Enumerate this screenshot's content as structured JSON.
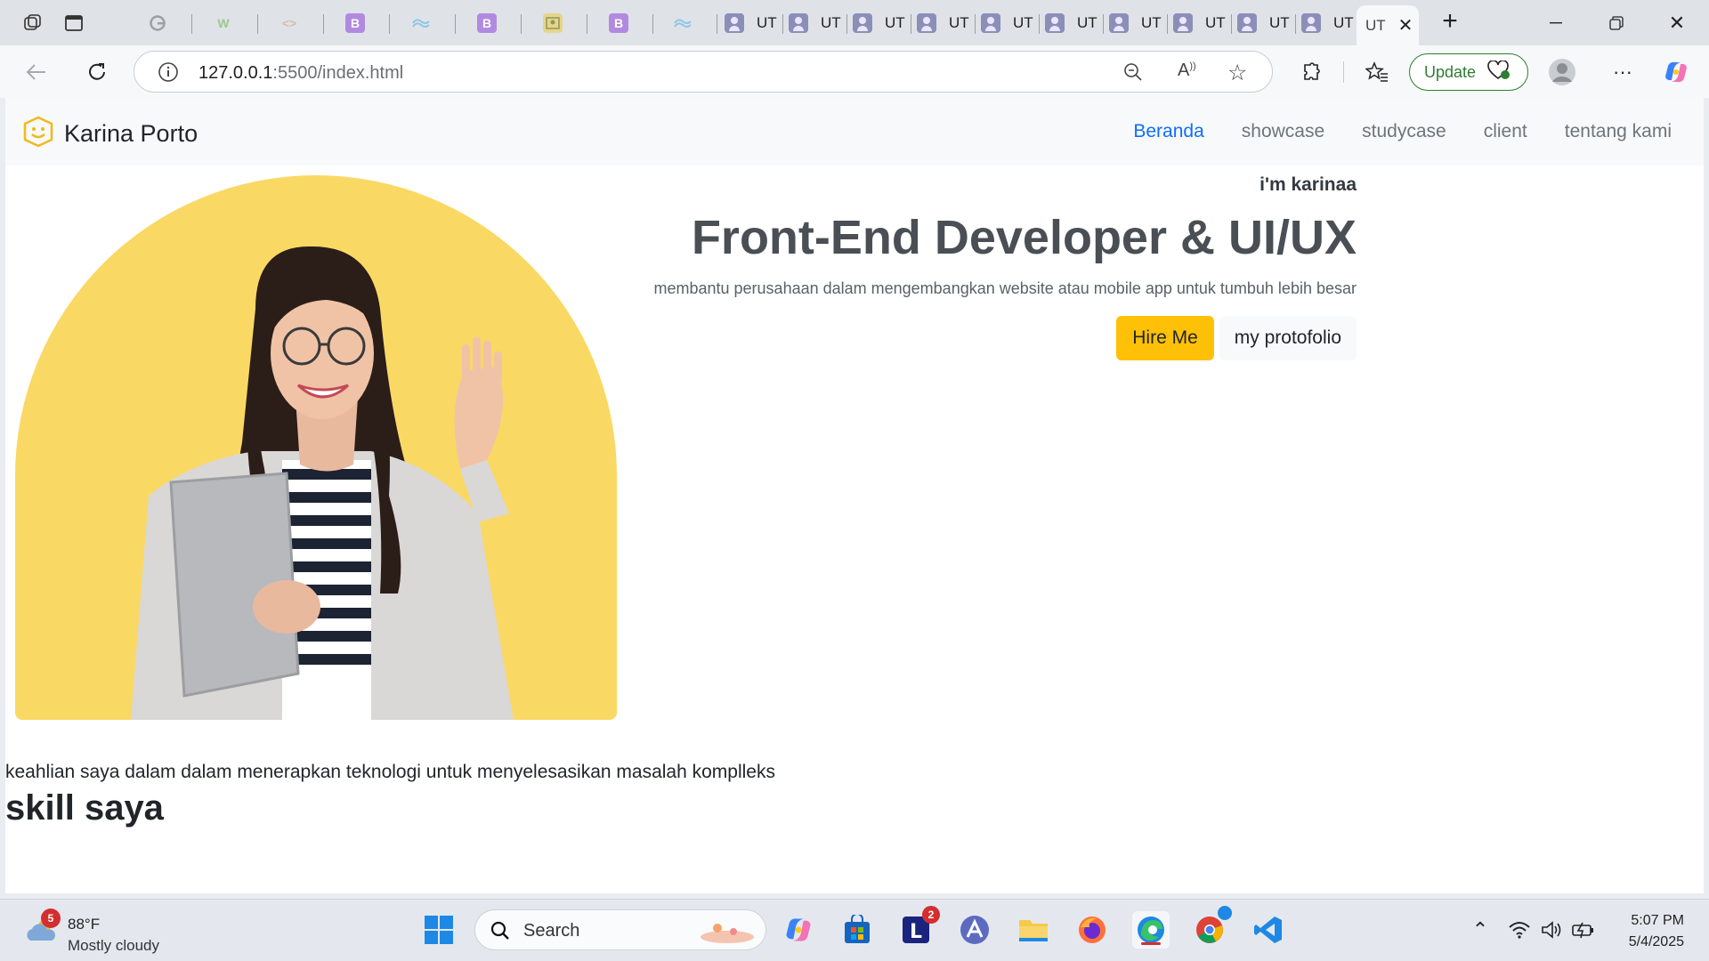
{
  "browser": {
    "tab_title_short": "UT",
    "active_tab_title": "UT",
    "url_host": "127.0.0.1",
    "url_rest": ":5500/index.html",
    "update_label": "Update"
  },
  "site": {
    "brand": "Karina Porto",
    "nav": [
      "Beranda",
      "showcase",
      "studycase",
      "client",
      "tentang kami"
    ],
    "greeting": "i'm karinaa",
    "headline": "Front-End Developer & UI/UX",
    "lead": "membantu perusahaan dalam mengembangkan website atau mobile app untuk tumbuh lebih besar",
    "hire_label": "Hire Me",
    "portfolio_label": "my protofolio",
    "skill_subtitle": "keahlian saya dalam dalam menerapkan teknologi untuk menyelesasikan masalah komplleks",
    "skill_title": "skill saya",
    "hero_bg_color": "#fad864"
  },
  "taskbar": {
    "weather_temp": "88°F",
    "weather_cond": "Mostly cloudy",
    "weather_badge": "5",
    "search_placeholder": "Search",
    "lens_badge": "2",
    "time": "5:07 PM",
    "date": "5/4/2025"
  }
}
